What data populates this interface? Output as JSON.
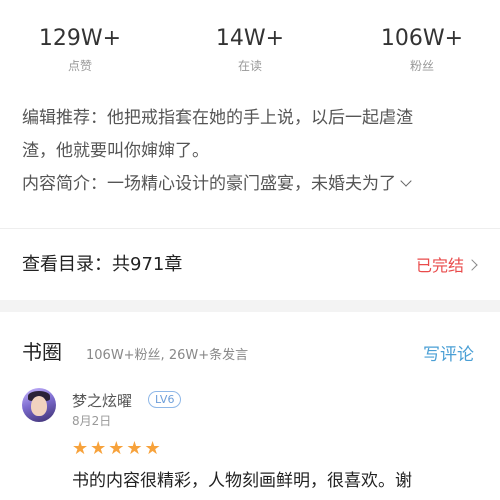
{
  "stats": [
    {
      "value": "129W+",
      "label": "点赞"
    },
    {
      "value": "14W+",
      "label": "在读"
    },
    {
      "value": "106W+",
      "label": "粉丝"
    }
  ],
  "intro": {
    "recommend_line1": "编辑推荐：他把戒指套在她的手上说，以后一起虐渣",
    "recommend_line2": "渣，他就要叫你婶婶了。",
    "summary": "内容简介：一场精心设计的豪门盛宴，未婚夫为了"
  },
  "catalog": {
    "title": "查看目录：共971章",
    "status": "已完结"
  },
  "book_circle": {
    "title": "书圈",
    "meta": "106W+粉丝, 26W+条发言",
    "write_label": "写评论"
  },
  "comment": {
    "username": "梦之炫曜",
    "level": "LV6",
    "date": "8月2日",
    "stars": "★★★★★",
    "rating": 5,
    "text": "书的内容很精彩，人物刻画鲜明，很喜欢。谢"
  },
  "colors": {
    "accent_blue": "#4a9fd5",
    "status_red": "#e94b4b",
    "star_orange": "#f7a23b"
  }
}
